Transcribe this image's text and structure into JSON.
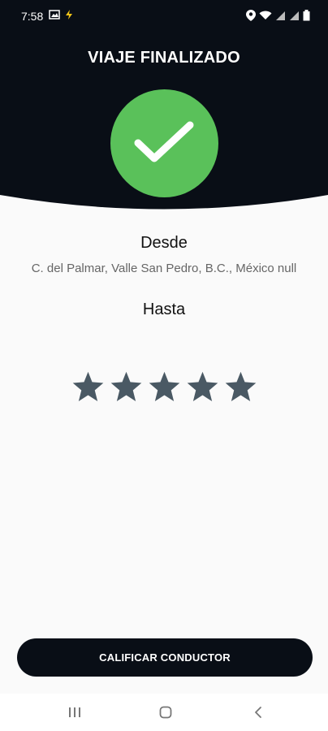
{
  "status_bar": {
    "time": "7:58"
  },
  "header": {
    "title": "VIAJE FINALIZADO"
  },
  "trip": {
    "from_label": "Desde",
    "from_address": "C. del Palmar, Valle San Pedro, B.C., México null",
    "to_label": "Hasta"
  },
  "rating": {
    "max_stars": 5
  },
  "actions": {
    "rate_button_label": "CALIFICAR CONDUCTOR"
  },
  "colors": {
    "header_background": "#090e16",
    "success_green": "#5ac15a",
    "star_color": "#4a5964",
    "button_background": "#090e16"
  }
}
